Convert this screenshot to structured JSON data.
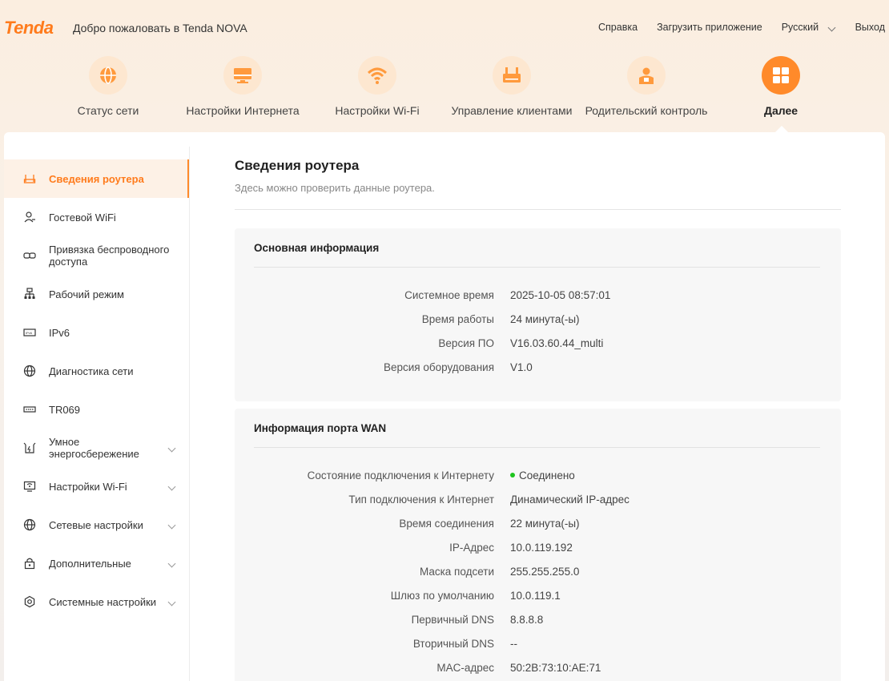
{
  "header": {
    "logo": "Tenda",
    "welcome": "Добро пожаловать в Tenda NOVA",
    "links": {
      "help": "Справка",
      "download_app": "Загрузить приложение",
      "language": "Русский",
      "logout": "Выход"
    }
  },
  "nav": {
    "items": [
      {
        "label": "Статус сети",
        "icon": "globe-icon"
      },
      {
        "label": "Настройки Интернета",
        "icon": "monitor-icon"
      },
      {
        "label": "Настройки Wi-Fi",
        "icon": "wifi-icon"
      },
      {
        "label": "Управление клиентами",
        "icon": "router-icon"
      },
      {
        "label": "Родительский контроль",
        "icon": "parent-icon"
      },
      {
        "label": "Далее",
        "icon": "grid-icon",
        "active": true
      }
    ]
  },
  "sidebar": {
    "items": [
      {
        "label": "Сведения роутера",
        "icon": "router-icon",
        "active": true
      },
      {
        "label": "Гостевой WiFi",
        "icon": "guest-icon"
      },
      {
        "label": "Привязка беспроводного доступа",
        "icon": "link-icon"
      },
      {
        "label": "Рабочий режим",
        "icon": "network-icon"
      },
      {
        "label": "IPv6",
        "icon": "ipv6-icon"
      },
      {
        "label": "Диагностика сети",
        "icon": "globe-icon"
      },
      {
        "label": "TR069",
        "icon": "tr069-icon"
      },
      {
        "label": "Умное энергосбережение",
        "icon": "energy-icon",
        "expandable": true
      },
      {
        "label": "Настройки Wi-Fi",
        "icon": "wifi-settings-icon",
        "expandable": true
      },
      {
        "label": "Сетевые настройки",
        "icon": "globe-icon",
        "expandable": true
      },
      {
        "label": "Дополнительные",
        "icon": "lock-icon",
        "expandable": true
      },
      {
        "label": "Системные настройки",
        "icon": "gear-icon",
        "expandable": true
      }
    ]
  },
  "page": {
    "title": "Сведения роутера",
    "subtitle": "Здесь можно проверить данные роутера."
  },
  "basic_info": {
    "title": "Основная информация",
    "rows": [
      {
        "key": "Системное время",
        "value": "2025-10-05 08:57:01"
      },
      {
        "key": "Время работы",
        "value": "24 минута(-ы)"
      },
      {
        "key": "Версия ПО",
        "value": "V16.03.60.44_multi"
      },
      {
        "key": "Версия оборудования",
        "value": "V1.0"
      }
    ]
  },
  "wan_info": {
    "title": "Информация порта WAN",
    "status_color": "#1ec41e",
    "rows": [
      {
        "key": "Состояние подключения к Интернету",
        "value": "Соединено",
        "status": true
      },
      {
        "key": "Тип подключения к Интернет",
        "value": "Динамический IP-адрес"
      },
      {
        "key": "Время соединения",
        "value": "22 минута(-ы)"
      },
      {
        "key": "IP-Адрес",
        "value": "10.0.119.192"
      },
      {
        "key": "Маска подсети",
        "value": "255.255.255.0"
      },
      {
        "key": "Шлюз по умолчанию",
        "value": "10.0.119.1"
      },
      {
        "key": "Первичный DNS",
        "value": "8.8.8.8"
      },
      {
        "key": "Вторичный DNS",
        "value": "--"
      },
      {
        "key": "MAC-адрес",
        "value": "50:2B:73:10:AE:71"
      }
    ]
  },
  "colors": {
    "accent": "#ff8a2a",
    "brand": "#ff7b1c",
    "icon_bg": "#fde7d0"
  }
}
